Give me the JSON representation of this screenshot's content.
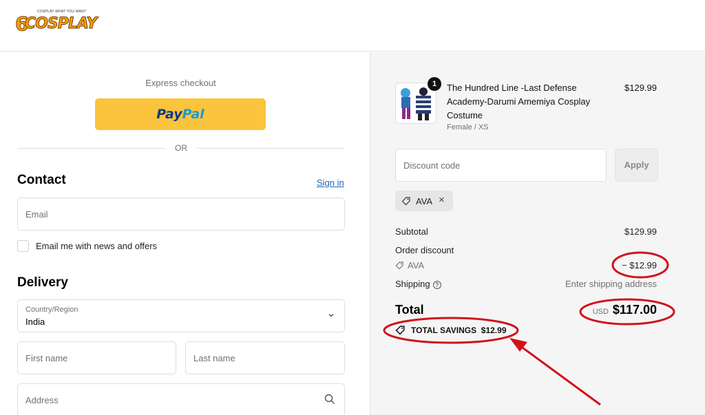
{
  "header": {
    "logo_word": "COSPLAY",
    "logo_tagline": "COSPLAY WHAT YOU WANT"
  },
  "checkout": {
    "express_label": "Express checkout",
    "paypal_part1": "Pay",
    "paypal_part2": "Pal",
    "or_label": "OR"
  },
  "contact": {
    "title": "Contact",
    "signin_label": "Sign in",
    "email_placeholder": "Email",
    "newsletter_label": "Email me with news and offers",
    "newsletter_checked": false
  },
  "delivery": {
    "title": "Delivery",
    "country_label": "Country/Region",
    "country_value": "India",
    "first_name_placeholder": "First name",
    "last_name_placeholder": "Last name",
    "address_placeholder": "Address"
  },
  "order": {
    "quantity": "1",
    "product_title": "The Hundred Line -Last Defense Academy-Darumi Amemiya Cosplay Costume",
    "product_variant": "Female / XS",
    "product_price": "$129.99",
    "discount_placeholder": "Discount code",
    "apply_label": "Apply",
    "applied_code": "AVA",
    "subtotal_label": "Subtotal",
    "subtotal_value": "$129.99",
    "order_discount_label": "Order discount",
    "discount_code": "AVA",
    "discount_value": "− $12.99",
    "shipping_label": "Shipping",
    "shipping_value": "Enter shipping address",
    "total_label": "Total",
    "currency": "USD",
    "total_value": "$117.00",
    "savings_text": "TOTAL SAVINGS  $12.99"
  },
  "colors": {
    "paypal_yellow": "#fcc43c",
    "link_blue": "#1d66b5",
    "annotation_red": "#d0121b",
    "summary_bg": "#f5f5f5"
  }
}
